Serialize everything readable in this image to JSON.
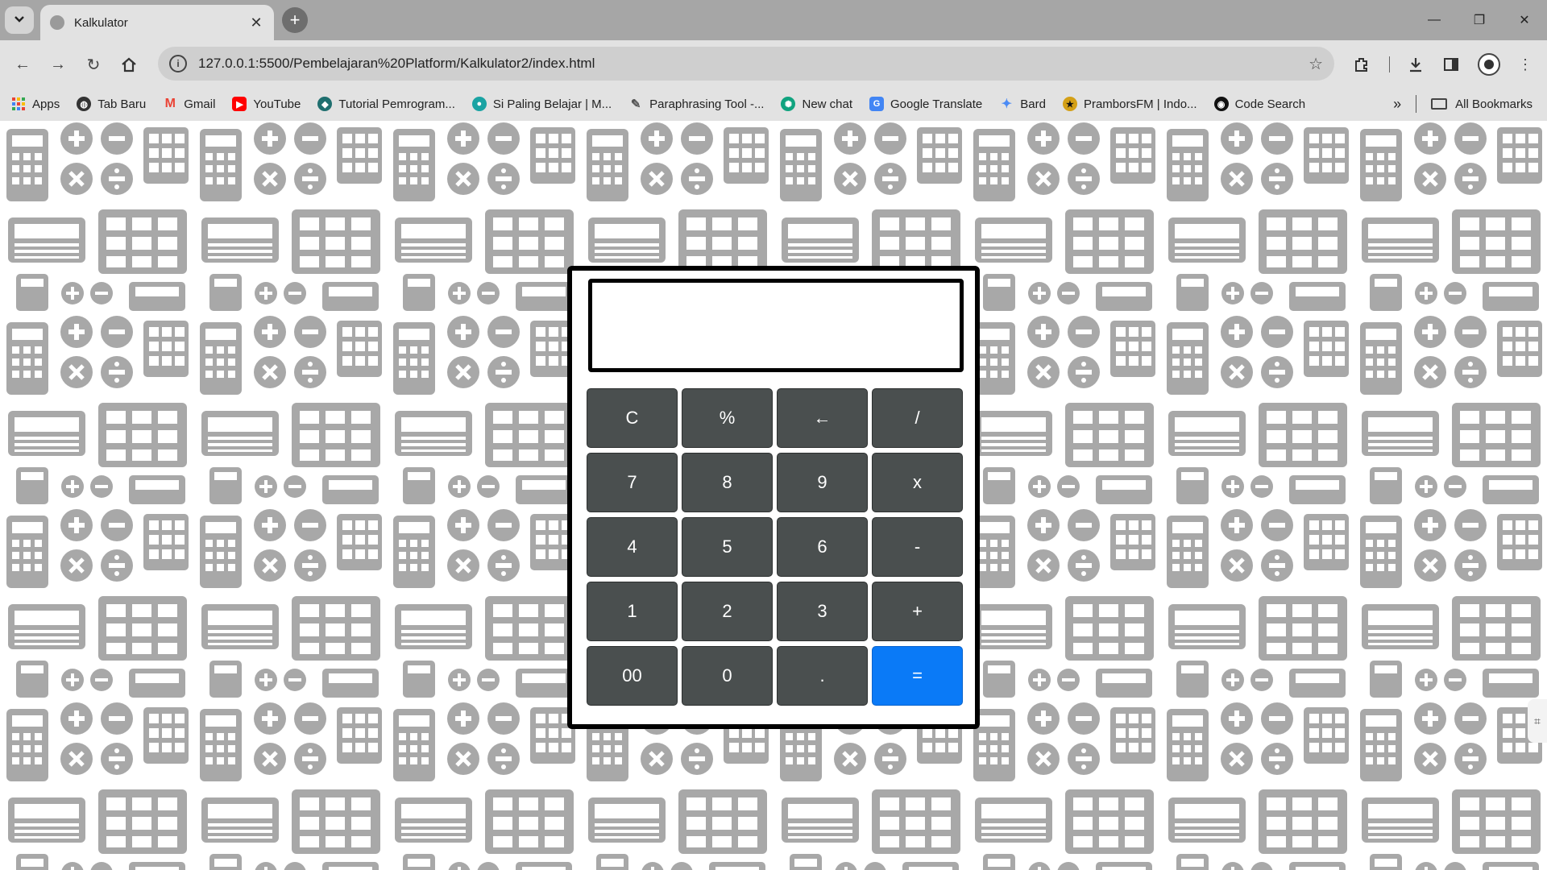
{
  "browser": {
    "tab_title": "Kalkulator",
    "url": "127.0.0.1:5500/Pembelajaran%20Platform/Kalkulator2/index.html",
    "bookmarks": [
      {
        "label": "Apps",
        "icon": "apps-grid-icon",
        "color": "#4285f4"
      },
      {
        "label": "Tab Baru",
        "icon": "globe-icon",
        "color": "#333333"
      },
      {
        "label": "Gmail",
        "icon": "gmail-icon",
        "color": "#ea4335"
      },
      {
        "label": "YouTube",
        "icon": "youtube-icon",
        "color": "#ff0000"
      },
      {
        "label": "Tutorial Pemrogram...",
        "icon": "site-icon",
        "color": "#1f6f6f"
      },
      {
        "label": "Si Paling Belajar | M...",
        "icon": "site-icon",
        "color": "#1aa3a3"
      },
      {
        "label": "Paraphrasing Tool -...",
        "icon": "quill-icon",
        "color": "#666666"
      },
      {
        "label": "New chat",
        "icon": "chatgpt-icon",
        "color": "#10a37f"
      },
      {
        "label": "Google Translate",
        "icon": "translate-icon",
        "color": "#4285f4"
      },
      {
        "label": "Bard",
        "icon": "sparkle-icon",
        "color": "#4b8bf5"
      },
      {
        "label": "PramborsFM | Indo...",
        "icon": "radio-icon",
        "color": "#d4a017"
      },
      {
        "label": "Code Search",
        "icon": "code-search-icon",
        "color": "#111111"
      }
    ],
    "all_bookmarks": "All Bookmarks"
  },
  "calculator": {
    "display_value": "",
    "keys": [
      "C",
      "%",
      "←",
      "/",
      "7",
      "8",
      "9",
      "x",
      "4",
      "5",
      "6",
      "-",
      "1",
      "2",
      "3",
      "+",
      "00",
      "0",
      ".",
      "="
    ],
    "accent_color": "#0a7af7",
    "key_color": "#4a4f4f"
  }
}
